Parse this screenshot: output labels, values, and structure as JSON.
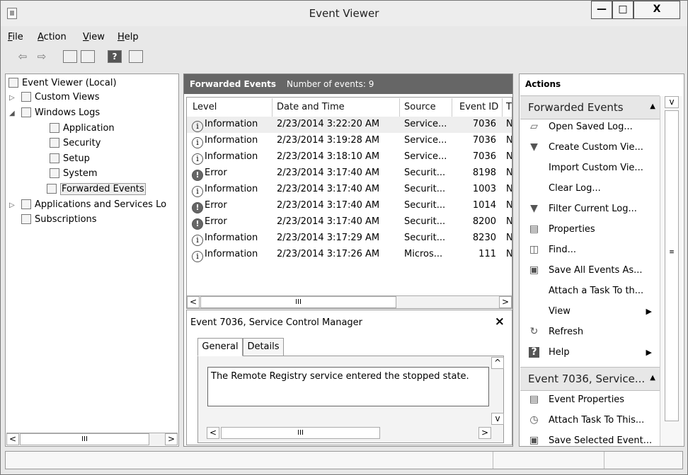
{
  "window": {
    "title": "Event Viewer",
    "minimize": "—",
    "maximize": "□",
    "close": "X"
  },
  "menu": [
    {
      "label": "File",
      "access": "F"
    },
    {
      "label": "Action",
      "access": "A"
    },
    {
      "label": "View",
      "access": "V"
    },
    {
      "label": "Help",
      "access": "H"
    }
  ],
  "tree": {
    "root": "Event Viewer (Local)",
    "custom_views": "Custom Views",
    "windows_logs": "Windows Logs",
    "application": "Application",
    "security": "Security",
    "setup": "Setup",
    "system": "System",
    "forwarded_events": "Forwarded Events",
    "applications_services": "Applications and Services Lo",
    "subscriptions": "Subscriptions",
    "scroll_thumb": "III"
  },
  "center": {
    "header_title": "Forwarded Events",
    "header_count": "Number of events: 9",
    "columns": [
      "Level",
      "Date and Time",
      "Source",
      "Event ID",
      "T"
    ],
    "rows": [
      {
        "level": "Information",
        "date": "2/23/2014 3:22:20 AM",
        "source": "Service...",
        "id": "7036",
        "t": "N"
      },
      {
        "level": "Information",
        "date": "2/23/2014 3:19:28 AM",
        "source": "Service...",
        "id": "7036",
        "t": "N"
      },
      {
        "level": "Information",
        "date": "2/23/2014 3:18:10 AM",
        "source": "Service...",
        "id": "7036",
        "t": "N"
      },
      {
        "level": "Error",
        "date": "2/23/2014 3:17:40 AM",
        "source": "Securit...",
        "id": "8198",
        "t": "N"
      },
      {
        "level": "Information",
        "date": "2/23/2014 3:17:40 AM",
        "source": "Securit...",
        "id": "1003",
        "t": "N"
      },
      {
        "level": "Error",
        "date": "2/23/2014 3:17:40 AM",
        "source": "Securit...",
        "id": "1014",
        "t": "N"
      },
      {
        "level": "Error",
        "date": "2/23/2014 3:17:40 AM",
        "source": "Securit...",
        "id": "8200",
        "t": "N"
      },
      {
        "level": "Information",
        "date": "2/23/2014 3:17:29 AM",
        "source": "Securit...",
        "id": "8230",
        "t": "N"
      },
      {
        "level": "Information",
        "date": "2/23/2014 3:17:26 AM",
        "source": "Micros...",
        "id": "111",
        "t": "N"
      }
    ],
    "scroll_thumb": "III",
    "detail_title": "Event 7036, Service Control Manager",
    "detail_close": "×",
    "tabs": [
      "General",
      "Details"
    ],
    "message": "The Remote Registry service entered the stopped state.",
    "message_scroll_thumb": "III"
  },
  "actions": {
    "header": "Actions",
    "section1": "Forwarded Events",
    "items1": [
      {
        "icon": "folder-open-icon",
        "glyph": "▱",
        "label": "Open Saved Log..."
      },
      {
        "icon": "filter-icon",
        "glyph": "▼",
        "label": "Create Custom Vie..."
      },
      {
        "icon": "none",
        "glyph": "",
        "label": "Import Custom Vie..."
      },
      {
        "icon": "none",
        "glyph": "",
        "label": "Clear Log..."
      },
      {
        "icon": "filter-icon",
        "glyph": "▼",
        "label": "Filter Current Log..."
      },
      {
        "icon": "properties-icon",
        "glyph": "▤",
        "label": "Properties"
      },
      {
        "icon": "find-icon",
        "glyph": "◫",
        "label": "Find..."
      },
      {
        "icon": "save-icon",
        "glyph": "▣",
        "label": "Save All Events As..."
      },
      {
        "icon": "none",
        "glyph": "",
        "label": "Attach a Task To th..."
      },
      {
        "icon": "none",
        "glyph": "",
        "label": "View",
        "arrow": "▶"
      },
      {
        "icon": "refresh-icon",
        "glyph": "↻",
        "label": "Refresh"
      },
      {
        "icon": "help-icon",
        "glyph": "?",
        "label": "Help",
        "arrow": "▶"
      }
    ],
    "section2": "Event 7036, Service...",
    "items2": [
      {
        "icon": "event-properties-icon",
        "glyph": "▤",
        "label": "Event Properties"
      },
      {
        "icon": "clock-task-icon",
        "glyph": "◷",
        "label": "Attach Task To This..."
      },
      {
        "icon": "save-icon",
        "glyph": "▣",
        "label": "Save Selected Event..."
      }
    ]
  }
}
